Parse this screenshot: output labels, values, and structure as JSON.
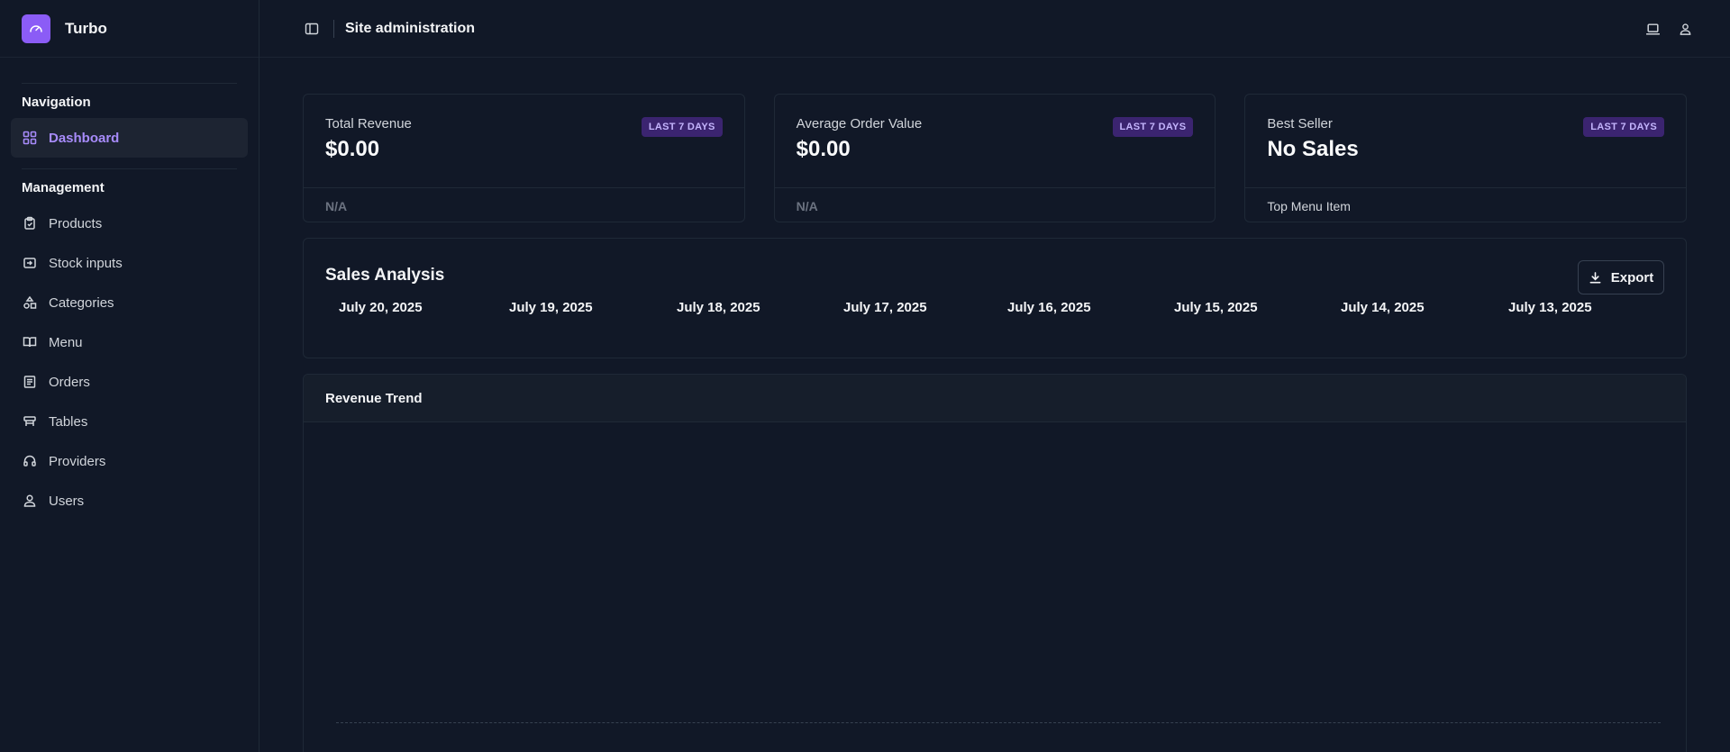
{
  "app": {
    "name": "Turbo"
  },
  "header": {
    "title": "Site administration"
  },
  "sidebar": {
    "sections": [
      {
        "title": "Navigation",
        "items": [
          {
            "label": "Dashboard",
            "icon": "grid-icon",
            "active": true
          }
        ]
      },
      {
        "title": "Management",
        "items": [
          {
            "label": "Products",
            "icon": "clipboard-icon"
          },
          {
            "label": "Stock inputs",
            "icon": "sign-in-icon"
          },
          {
            "label": "Categories",
            "icon": "shapes-icon"
          },
          {
            "label": "Menu",
            "icon": "book-icon"
          },
          {
            "label": "Orders",
            "icon": "receipt-icon"
          },
          {
            "label": "Tables",
            "icon": "table-icon"
          },
          {
            "label": "Providers",
            "icon": "headset-icon"
          },
          {
            "label": "Users",
            "icon": "user-icon"
          }
        ]
      }
    ]
  },
  "stats": [
    {
      "label": "Total Revenue",
      "value": "$0.00",
      "badge": "LAST 7 DAYS",
      "footer": "N/A"
    },
    {
      "label": "Average Order Value",
      "value": "$0.00",
      "badge": "LAST 7 DAYS",
      "footer": "N/A"
    },
    {
      "label": "Best Seller",
      "value": "No Sales",
      "badge": "LAST 7 DAYS",
      "footer": "Top Menu Item"
    }
  ],
  "sales_analysis": {
    "title": "Sales Analysis",
    "export_label": "Export",
    "dates": [
      "July 20, 2025",
      "July 19, 2025",
      "July 18, 2025",
      "July 17, 2025",
      "July 16, 2025",
      "July 15, 2025",
      "July 14, 2025",
      "July 13, 2025"
    ]
  },
  "revenue_trend": {
    "title": "Revenue Trend"
  },
  "colors": {
    "accent": "#8b5cf6",
    "background": "#111827",
    "badge_bg": "#3b2470"
  }
}
